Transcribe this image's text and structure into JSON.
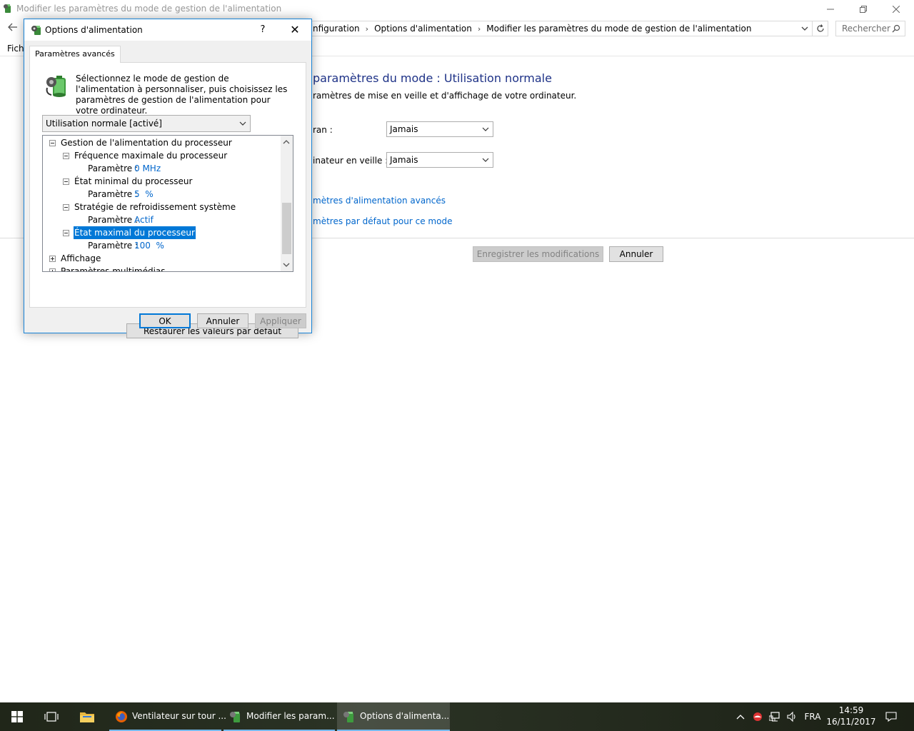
{
  "main_window": {
    "title": "Modifier les paramètres du mode de gestion de l'alimentation",
    "breadcrumbs": [
      "nfiguration",
      "Options d'alimentation",
      "Modifier les paramètres du mode de gestion de l'alimentation"
    ],
    "search_placeholder": "Rechercher",
    "menu_fich": "Fich",
    "heading": "paramètres du mode : Utilisation normale",
    "subtitle": "ramètres de mise en veille et d'affichage de votre ordinateur.",
    "settings": [
      {
        "label": "ran :",
        "value": "Jamais"
      },
      {
        "label": "inateur en veille :",
        "value": "Jamais"
      }
    ],
    "links": [
      "mètres d'alimentation avancés",
      "mètres par défaut pour ce mode"
    ],
    "save_label": "Enregistrer les modifications",
    "cancel_label": "Annuler"
  },
  "dialog": {
    "title": "Options d'alimentation",
    "help": "?",
    "close": "✕",
    "tab_label": "Paramètres avancés",
    "description": "Sélectionnez le mode de gestion de l'alimentation à personnaliser, puis choisissez les paramètres de gestion de l'alimentation pour votre ordinateur.",
    "plan_selected": "Utilisation normale [activé]",
    "tree": {
      "root": "Gestion de l'alimentation du processeur",
      "param_label": "Paramètre :",
      "items": [
        {
          "label": "Fréquence maximale du processeur",
          "value": "0 MHz"
        },
        {
          "label": "État minimal du processeur",
          "value": "5  %"
        },
        {
          "label": "Stratégie de refroidissement système",
          "value": "Actif"
        },
        {
          "label": "État maximal du processeur",
          "value": "100  %"
        }
      ],
      "display": "Affichage",
      "multimedia": "Paramètres multimédias"
    },
    "restore_label": "Restaurer les valeurs par défaut",
    "ok_label": "OK",
    "cancel_label": "Annuler",
    "apply_label": "Appliquer"
  },
  "taskbar": {
    "apps": [
      {
        "label": "Ventilateur sur tour ..."
      },
      {
        "label": "Modifier les param..."
      },
      {
        "label": "Options d'alimenta..."
      }
    ],
    "language": "FRA",
    "time": "14:59",
    "date": "16/11/2017"
  },
  "colors": {
    "accent": "#0078d7",
    "link": "#0066cc",
    "heading": "#1e3287"
  }
}
